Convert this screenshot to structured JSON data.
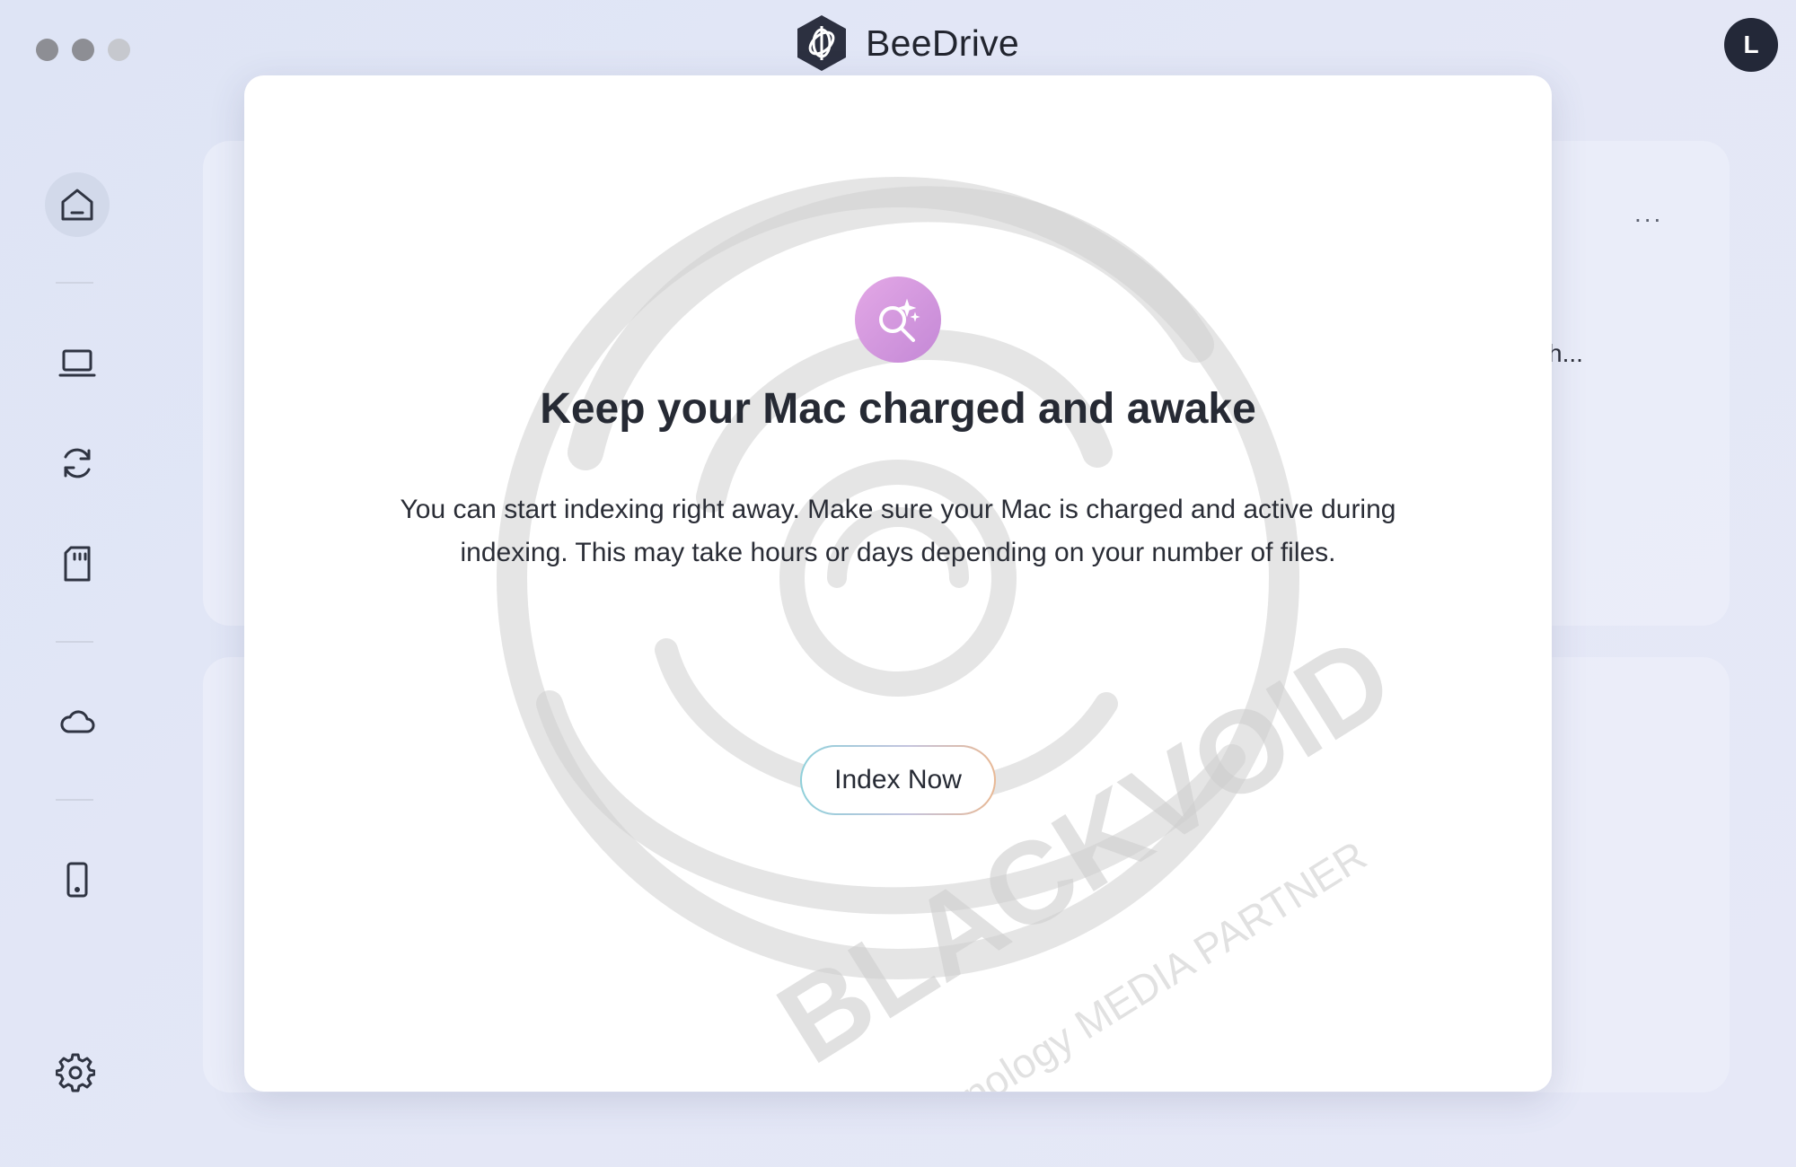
{
  "app": {
    "title": "BeeDrive",
    "avatar_initial": "L"
  },
  "window_controls": [
    "close",
    "minimize",
    "zoom"
  ],
  "sidebar": {
    "items": [
      {
        "icon": "home-icon",
        "active": true
      },
      {
        "icon": "laptop-icon",
        "active": false
      },
      {
        "icon": "sync-icon",
        "active": false
      },
      {
        "icon": "sd-card-icon",
        "active": false
      },
      {
        "icon": "cloud-icon",
        "active": false
      },
      {
        "icon": "phone-icon",
        "active": false
      },
      {
        "icon": "gear-icon",
        "active": false
      }
    ]
  },
  "background": {
    "more_label": "...",
    "snippet": "h..."
  },
  "modal": {
    "icon": "search-sparkle-icon",
    "title": "Keep your Mac charged and awake",
    "body": "You can start indexing right away. Make sure your Mac is charged and active during indexing. This may take hours or days depending on your number of files.",
    "button_label": "Index Now"
  },
  "watermark": {
    "brand": "BLACKVOID",
    "partner": "Synology MEDIA PARTNER"
  },
  "colors": {
    "background": "#e2e6f6",
    "modal": "#ffffff",
    "icon_gradient_start": "#e3a8e6",
    "icon_gradient_end": "#c488d6",
    "avatar": "#232838"
  }
}
